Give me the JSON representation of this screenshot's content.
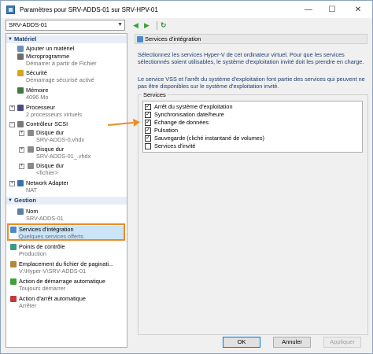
{
  "window": {
    "title": "Paramètres pour SRV-ADDS-01 sur SRV-HPV-01",
    "minimize": "—",
    "maximize": "☐",
    "close": "✕"
  },
  "toolbar": {
    "vm_name": "SRV-ADDS-01",
    "back": "◀",
    "forward": "▶",
    "refresh": "↻"
  },
  "tree": {
    "hardware_header": "Matériel",
    "management_header": "Gestion",
    "hardware": [
      {
        "label": "Ajouter un matériel",
        "sub": ""
      },
      {
        "label": "Microprogramme",
        "sub": "Démarrer à partir de Fichier"
      },
      {
        "label": "Sécurité",
        "sub": "Démarrage sécurisé activé"
      },
      {
        "label": "Mémoire",
        "sub": "4096 Mo"
      },
      {
        "label": "Processeur",
        "sub": "2 processeurs virtuels"
      },
      {
        "label": "Contrôleur SCSI",
        "sub": ""
      },
      {
        "label": "Disque dur",
        "sub": "SRV-ADDS-0.vhdx"
      },
      {
        "label": "Disque dur",
        "sub": "SRV-ADDS-01_.vhdx"
      },
      {
        "label": "Disque dur",
        "sub": "<fichier>"
      },
      {
        "label": "Network Adapter",
        "sub": "NAT"
      }
    ],
    "management": [
      {
        "label": "Nom",
        "sub": "SRV-ADDS-01"
      },
      {
        "label": "Services d'intégration",
        "sub": "Quelques services offerts"
      },
      {
        "label": "Points de contrôle",
        "sub": "Production"
      },
      {
        "label": "Emplacement du fichier de paginati...",
        "sub": "V:\\Hyper-V\\SRV-ADDS-01"
      },
      {
        "label": "Action de démarrage automatique",
        "sub": "Toujours démarrer"
      },
      {
        "label": "Action d'arrêt automatique",
        "sub": "Arrêter"
      }
    ]
  },
  "panel": {
    "title": "Services d'intégration",
    "desc1": "Sélectionnez les services Hyper-V de cet ordinateur virtuel. Pour que les services sélectionnés soient utilisables, le système d'exploitation invité doit les prendre en charge.",
    "desc2": "Le service VSS et l'arrêt du système d'exploitation font partie des services qui peuvent ne pas être disponibles sur le système d'exploitation invité.",
    "services_label": "Services",
    "services": [
      {
        "label": "Arrêt du système d'exploitation",
        "checked": true
      },
      {
        "label": "Synchronisation date/heure",
        "checked": true
      },
      {
        "label": "Échange de données",
        "checked": true
      },
      {
        "label": "Pulsation",
        "checked": true
      },
      {
        "label": "Sauvegarde (cliché instantané de volumes)",
        "checked": true
      },
      {
        "label": "Services d'invité",
        "checked": false
      }
    ]
  },
  "buttons": {
    "ok": "OK",
    "cancel": "Annuler",
    "apply": "Appliquer"
  },
  "colors": {
    "annotation": "#f08a24",
    "section_text": "#1e3d6e",
    "selection": "#cce4f7"
  }
}
